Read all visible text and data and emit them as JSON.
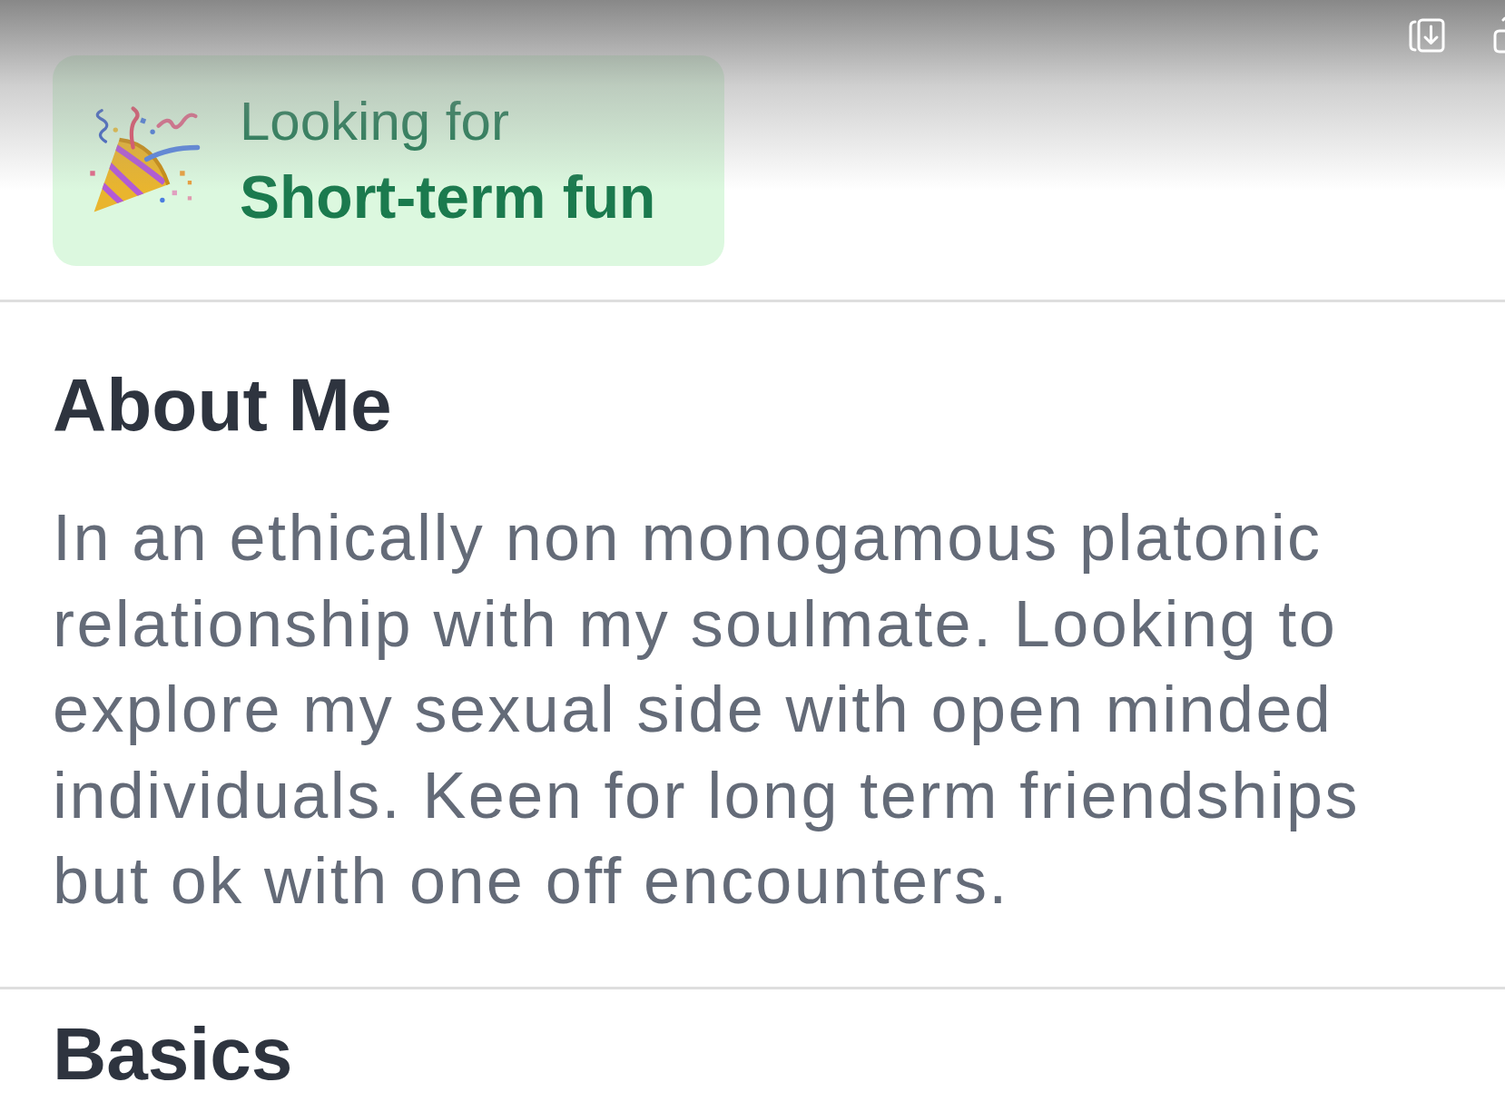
{
  "looking_for": {
    "label": "Looking for",
    "value": "Short-term fun"
  },
  "about_me": {
    "title": "About Me",
    "text": "In an ethically non monogamous platonic relationship with my soulmate. Looking to explore my sexual side with open minded individuals. Keen for long term friendships but ok with one off encounters."
  },
  "basics": {
    "title": "Basics"
  }
}
